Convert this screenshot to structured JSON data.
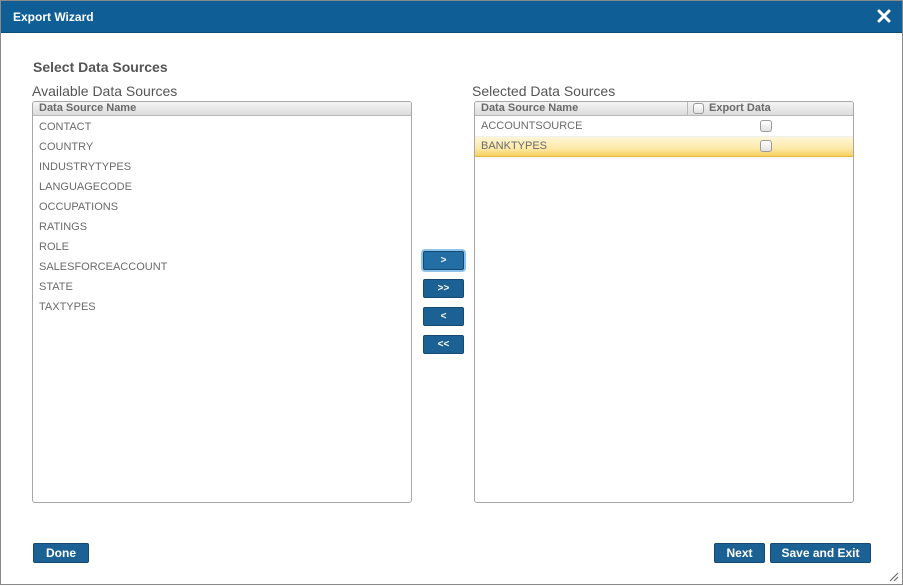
{
  "window": {
    "title": "Export Wizard",
    "close_icon": "close-icon"
  },
  "section_title": "Select Data Sources",
  "available": {
    "label": "Available Data Sources",
    "column_header": "Data Source Name",
    "items": [
      "CONTACT",
      "COUNTRY",
      "INDUSTRYTYPES",
      "LANGUAGECODE",
      "OCCUPATIONS",
      "RATINGS",
      "ROLE",
      "SALESFORCEACCOUNT",
      "STATE",
      "TAXTYPES"
    ]
  },
  "selected": {
    "label": "Selected Data Sources",
    "columns": {
      "name": "Data Source Name",
      "export": "Export Data"
    },
    "export_all_checked": false,
    "rows": [
      {
        "name": "ACCOUNTSOURCE",
        "export": false,
        "selected": false
      },
      {
        "name": "BANKTYPES",
        "export": false,
        "selected": true
      }
    ]
  },
  "transfer_buttons": {
    "move_one": ">",
    "move_all": ">>",
    "remove_one": "<",
    "remove_all": "<<"
  },
  "footer": {
    "done": "Done",
    "next": "Next",
    "save_exit": "Save and Exit"
  },
  "colors": {
    "titlebar": "#0f5f96",
    "button": "#1c6193",
    "selection": "#fde9a8"
  }
}
